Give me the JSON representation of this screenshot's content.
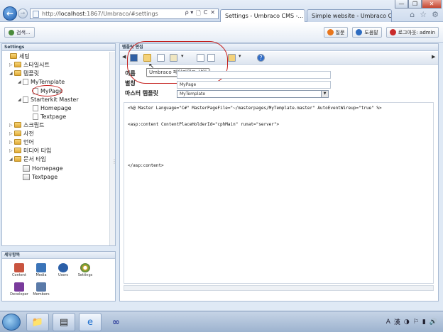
{
  "browser": {
    "url_prefix": "http://",
    "url_host": "localhost",
    "url_rest": ":1867/Umbraco/#settings",
    "addr_buttons": [
      "ρ ▾",
      "🗋",
      "C",
      "✕"
    ],
    "tabs": [
      {
        "title": "Settings - Umbraco CMS -...",
        "active": true,
        "close": "✕"
      },
      {
        "title": "Simple website - Umbraco C...",
        "active": false
      }
    ],
    "window_controls": [
      "—",
      "❐",
      "✕"
    ],
    "icons": [
      "⌂",
      "☆",
      "⚙"
    ]
  },
  "topbar": {
    "left_button": "검색...",
    "right_buttons": [
      {
        "label": "질문",
        "color": "#e8761c"
      },
      {
        "label": "도움말",
        "color": "#2e6cc0"
      },
      {
        "label": "로그아웃: admin",
        "color": "#c92a2a"
      }
    ]
  },
  "left": {
    "header": "Settings",
    "tree": [
      {
        "label": "세팅",
        "arrow": "",
        "icon": "folder"
      },
      {
        "label": "스타일시트",
        "arrow": "▷",
        "icon": "folder"
      },
      {
        "label": "템플릿",
        "arrow": "◢",
        "icon": "folder"
      },
      {
        "label": "MyTemplate",
        "arrow": "◢",
        "icon": "doc"
      },
      {
        "label": "MyPage",
        "arrow": "",
        "icon": "doc"
      },
      {
        "label": "Starterkit Master",
        "arrow": "◢",
        "icon": "doc"
      },
      {
        "label": "Homepage",
        "arrow": "",
        "icon": "doc"
      },
      {
        "label": "Textpage",
        "arrow": "",
        "icon": "doc"
      },
      {
        "label": "스크립트",
        "arrow": "▷",
        "icon": "folder"
      },
      {
        "label": "사전",
        "arrow": "▷",
        "icon": "folder"
      },
      {
        "label": "언어",
        "arrow": "▷",
        "icon": "folder"
      },
      {
        "label": "미디어 타입",
        "arrow": "▷",
        "icon": "folder"
      },
      {
        "label": "문서 타입",
        "arrow": "◢",
        "icon": "folder"
      },
      {
        "label": "Homepage",
        "arrow": "",
        "icon": "doctype"
      },
      {
        "label": "Textpage",
        "arrow": "",
        "icon": "doctype"
      }
    ],
    "sections_header": "세부항목",
    "sections": [
      {
        "label": "Content",
        "color": "#c9543f"
      },
      {
        "label": "Media",
        "color": "#3b74b8"
      },
      {
        "label": "Users",
        "color": "#2b5fa8"
      },
      {
        "label": "Settings",
        "color": "#d9a22a"
      },
      {
        "label": "Developer",
        "color": "#7a3b9c"
      },
      {
        "label": "Members",
        "color": "#5a7aa8"
      }
    ]
  },
  "main": {
    "header": "템플릿 편집",
    "tooltip": "Umbraco 페이지필드 삽입",
    "fields": {
      "name_label": "이름",
      "alias_label": "별칭",
      "alias_value": "MyPage",
      "master_label": "마스터 템플릿",
      "master_value": "MyTemplate"
    },
    "code": [
      "<%@ Master Language=\"C#\" MasterPageFile=\"~/masterpages/MyTemplate.master\" AutoEventWireup=\"true\" %>",
      "<asp:content ContentPlaceHolderId=\"cphMain\" runat=\"server\">",
      "</asp:content>"
    ]
  },
  "taskbar": {
    "tray_items": [
      "A",
      "漢",
      "◑",
      "⚐",
      "▮",
      "🔊"
    ]
  }
}
